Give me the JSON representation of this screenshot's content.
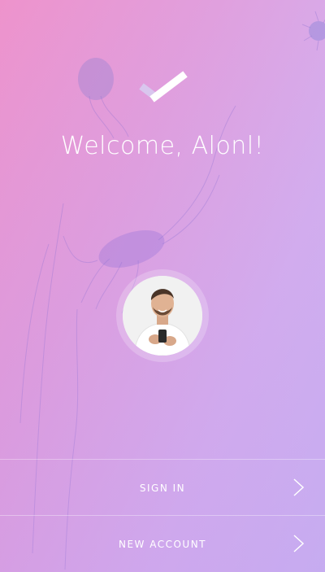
{
  "colors": {
    "gradient_start": "#ee93cc",
    "gradient_end": "#c9b6f4",
    "text": "#ffffff"
  },
  "header": {
    "icon": "checkmark-icon",
    "title": "Welcome, Alonl!"
  },
  "profile": {
    "avatar": "user-avatar-photo"
  },
  "actions": {
    "sign_in": {
      "label": "SIGN IN",
      "icon": "chevron-right-icon"
    },
    "new_account": {
      "label": "NEW ACCOUNT",
      "icon": "chevron-right-icon"
    }
  }
}
